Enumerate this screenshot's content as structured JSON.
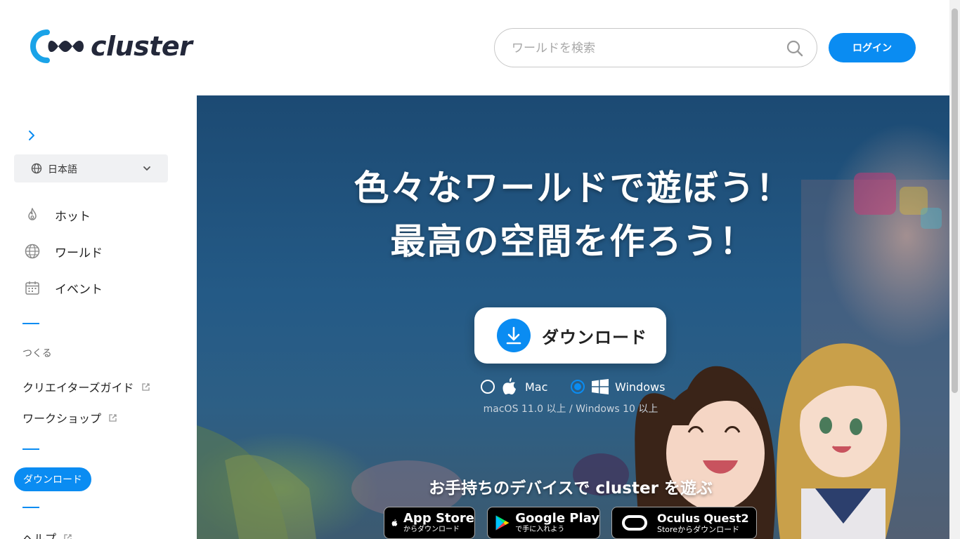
{
  "header": {
    "logo_text": "cluster",
    "search_placeholder": "ワールドを検索",
    "login_label": "ログイン"
  },
  "sidebar": {
    "language": "日本語",
    "nav": [
      {
        "label": "ホット",
        "icon": "flame-icon"
      },
      {
        "label": "ワールド",
        "icon": "globe-icon"
      },
      {
        "label": "イベント",
        "icon": "calendar-icon"
      }
    ],
    "create_section_label": "つくる",
    "create_links": [
      {
        "label": "クリエイターズガイド",
        "icon": "external-link-icon"
      },
      {
        "label": "ワークショップ",
        "icon": "external-link-icon"
      }
    ],
    "download_label": "ダウンロード",
    "help_label": "ヘルプ"
  },
  "hero": {
    "title_line1": "色々なワールドで遊ぼう！",
    "title_line2": "最高の空間を作ろう！",
    "download_button_label": "ダウンロード",
    "os_options": [
      {
        "label": "Mac",
        "icon": "apple-icon",
        "selected": false
      },
      {
        "label": "Windows",
        "icon": "windows-icon",
        "selected": true
      }
    ],
    "os_requirements": "macOS 11.0 以上 / Windows 10 以上",
    "devices_title": "お手持ちのデバイスで cluster を遊ぶ",
    "stores": [
      {
        "main": "App Store",
        "sub": "からダウンロード",
        "icon": "apple-icon"
      },
      {
        "main": "Google Play",
        "sub": "で手に入れよう",
        "icon": "google-play-icon"
      },
      {
        "main": "Oculus Quest2",
        "sub": "Storeからダウンロード",
        "icon": "oculus-icon"
      }
    ]
  },
  "colors": {
    "accent": "#0a8cf2",
    "logo_dark": "#23283a",
    "hero_bg": "#245a86"
  }
}
